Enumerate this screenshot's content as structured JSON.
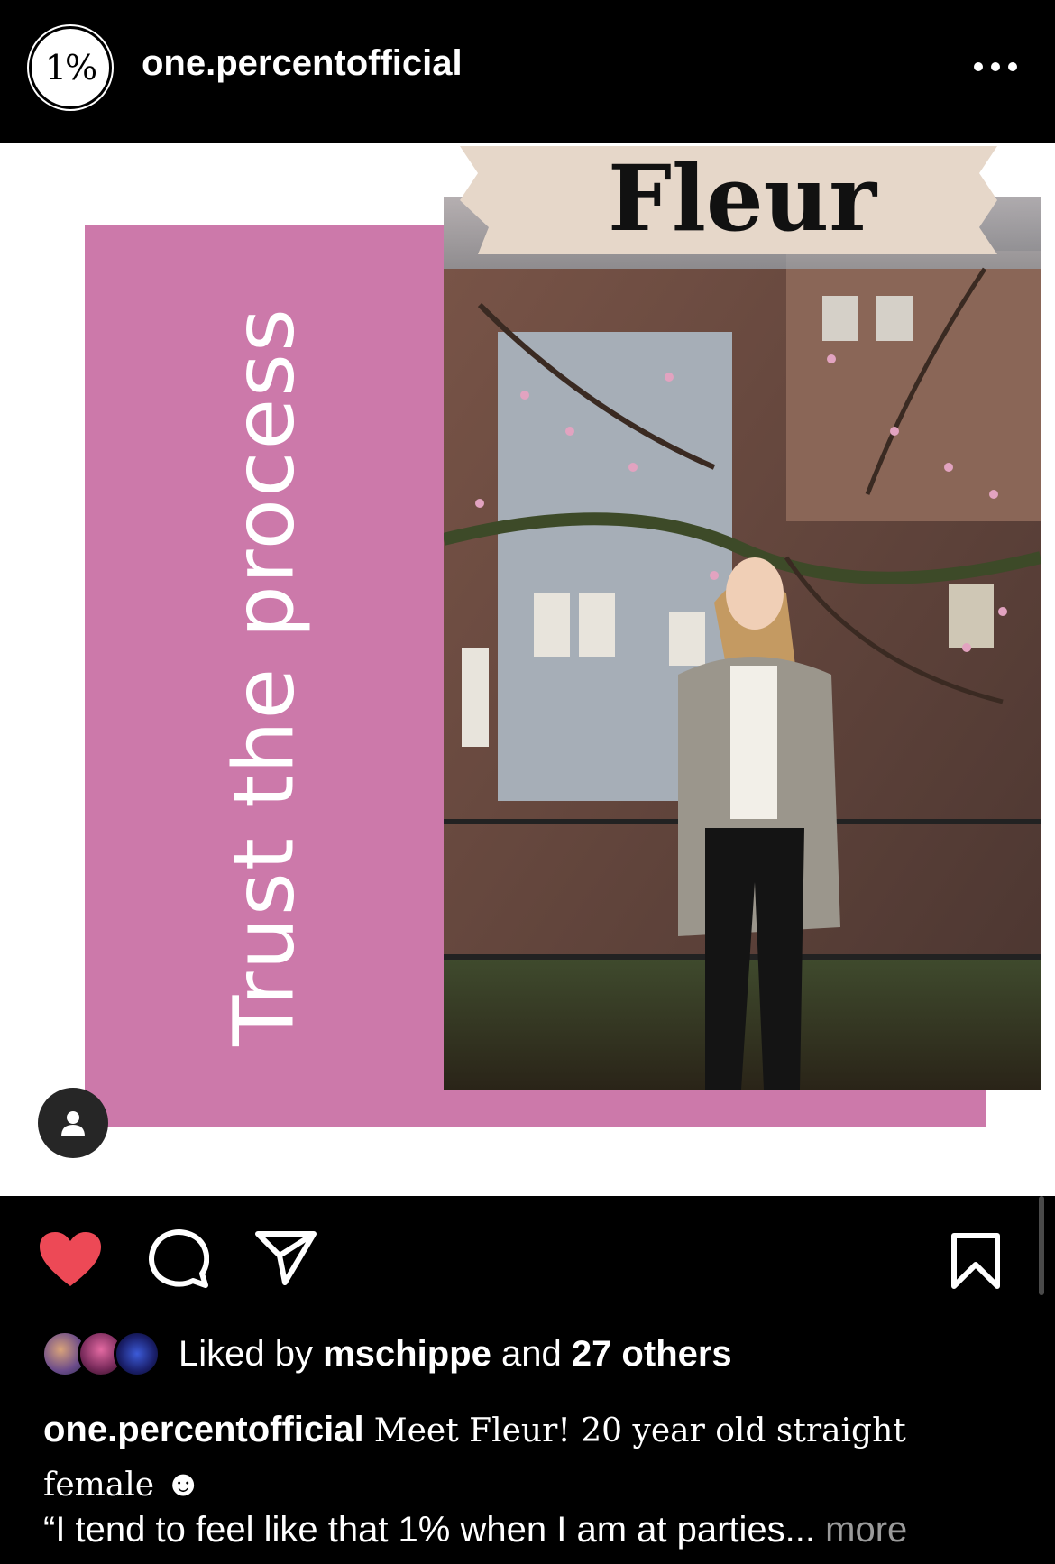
{
  "header": {
    "logo_text": "1%",
    "username": "one.percentofficial"
  },
  "post": {
    "banner_name": "Fleur",
    "vertical_text": "Trust the process",
    "colors": {
      "pink": "#cc79aa",
      "banner": "#e6d7c9"
    }
  },
  "actions": {
    "like_icon": "heart-filled",
    "like_color": "#ed4956",
    "comment_icon": "speech-bubble",
    "share_icon": "paper-plane",
    "save_icon": "bookmark"
  },
  "likes": {
    "prefix": "Liked by",
    "user": "mschippe",
    "joiner": "and",
    "others": "27 others"
  },
  "caption": {
    "username": "one.percentofficial",
    "text": "Meet Fleur! 20 year old straight female",
    "emoji": "☻",
    "quote": "“I tend to feel like that 1% when I am at parties...",
    "more": "more"
  }
}
